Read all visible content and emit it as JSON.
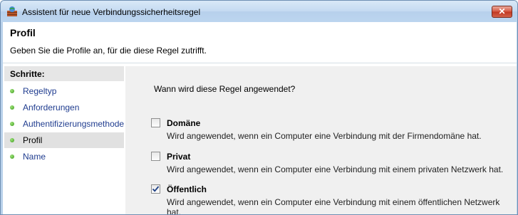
{
  "window": {
    "title": "Assistent für neue Verbindungssicherheitsregel",
    "close_glyph": "✕"
  },
  "header": {
    "title": "Profil",
    "description": "Geben Sie die Profile an, für die diese Regel zutrifft."
  },
  "steps": {
    "heading": "Schritte:",
    "items": [
      {
        "label": "Regeltyp",
        "active": false
      },
      {
        "label": "Anforderungen",
        "active": false
      },
      {
        "label": "Authentifizierungsmethode",
        "active": false
      },
      {
        "label": "Profil",
        "active": true
      },
      {
        "label": "Name",
        "active": false
      }
    ]
  },
  "main": {
    "question": "Wann wird diese Regel angewendet?",
    "options": [
      {
        "label": "Domäne",
        "description": "Wird angewendet, wenn ein Computer eine Verbindung mit der Firmendomäne hat.",
        "checked": false
      },
      {
        "label": "Privat",
        "description": "Wird angewendet, wenn ein Computer eine Verbindung mit einem privaten Netzwerk hat.",
        "checked": false
      },
      {
        "label": "Öffentlich",
        "description": "Wird angewendet, wenn ein Computer eine Verbindung mit einem öffentlichen Netzwerk hat.",
        "checked": true
      }
    ]
  }
}
